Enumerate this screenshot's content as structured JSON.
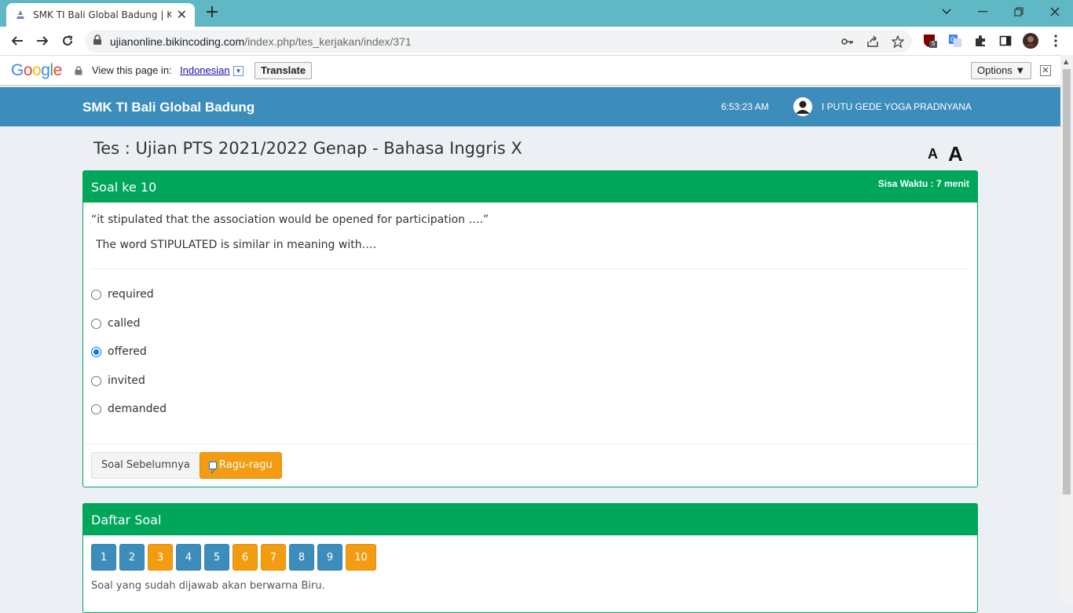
{
  "browser": {
    "tab_title": "SMK TI Bali Global Badung | Kerjakan",
    "url_host": "ujianonline.bikincoding.com",
    "url_path": "/index.php/tes_kerjakan/index/371",
    "extension_badge": "5"
  },
  "translate_bar": {
    "logo": "Google",
    "prompt": "View this page in:",
    "language": "Indonesian",
    "translate_label": "Translate",
    "options_label": "Options ▼"
  },
  "header": {
    "brand": "SMK TI Bali Global Badung",
    "clock": "6:53:23 AM",
    "user_name": "I PUTU GEDE YOGA PRADNYANA"
  },
  "page": {
    "title": "Tes : Ujian PTS 2021/2022 Genap - Bahasa Inggris X",
    "font_small": "A",
    "font_large": "A"
  },
  "question": {
    "header": "Soal ke 10",
    "time_left": "Sisa Waktu : 7 menit",
    "line1": "“it stipulated that the association would be opened for participation ….”",
    "line2": "The word STIPULATED is similar in meaning with….",
    "options": [
      {
        "label": "required",
        "checked": false
      },
      {
        "label": "called",
        "checked": false
      },
      {
        "label": "offered",
        "checked": true
      },
      {
        "label": "invited",
        "checked": false
      },
      {
        "label": "demanded",
        "checked": false
      }
    ],
    "prev_button": "Soal Sebelumnya",
    "doubt_button": "Ragu-ragu",
    "doubt_checked": true
  },
  "question_list": {
    "header": "Daftar Soal",
    "numbers": [
      {
        "n": "1",
        "state": "answered"
      },
      {
        "n": "2",
        "state": "answered"
      },
      {
        "n": "3",
        "state": "doubt"
      },
      {
        "n": "4",
        "state": "answered"
      },
      {
        "n": "5",
        "state": "answered"
      },
      {
        "n": "6",
        "state": "doubt"
      },
      {
        "n": "7",
        "state": "doubt"
      },
      {
        "n": "8",
        "state": "answered"
      },
      {
        "n": "9",
        "state": "answered"
      },
      {
        "n": "10",
        "state": "doubt"
      }
    ],
    "note": "Soal yang sudah dijawab akan berwarna Biru."
  },
  "colors": {
    "header_blue": "#3c8dbc",
    "box_green": "#00a65a",
    "answered": "#3c8dbc",
    "doubt": "#f39c12",
    "tab_strip": "#5fb8c3"
  }
}
